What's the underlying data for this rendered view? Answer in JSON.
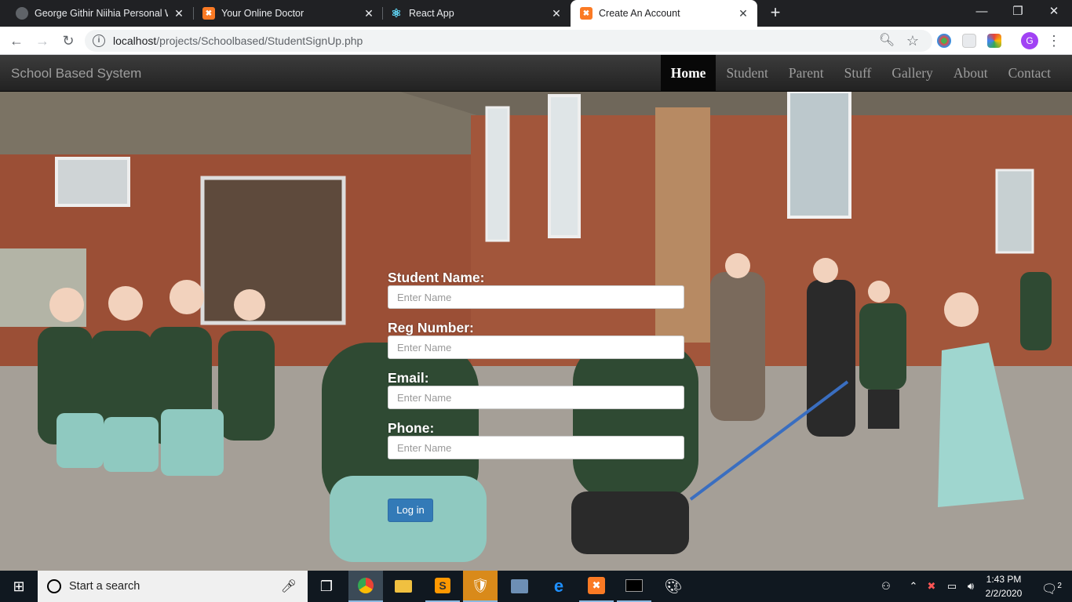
{
  "browser": {
    "tabs": [
      {
        "title": "George Githir Niihia Personal We",
        "icon": "globe-icon"
      },
      {
        "title": "Your Online Doctor",
        "icon": "xampp-icon"
      },
      {
        "title": "React App",
        "icon": "react-icon"
      },
      {
        "title": "Create An Account",
        "icon": "xampp-icon"
      }
    ],
    "close_glyph": "✕",
    "newtab_glyph": "+",
    "url_host": "localhost",
    "url_path": "/projects/Schoolbased/StudentSignUp.php",
    "avatar_letter": "G"
  },
  "site": {
    "brand": "School Based System",
    "nav": [
      "Home",
      "Student",
      "Parent",
      "Stuff",
      "Gallery",
      "About",
      "Contact"
    ],
    "active_nav": "Home"
  },
  "form": {
    "fields": [
      {
        "label": "Student Name:",
        "placeholder": "Enter Name"
      },
      {
        "label": "Reg Number:",
        "placeholder": "Enter Name"
      },
      {
        "label": "Email:",
        "placeholder": "Enter Name"
      },
      {
        "label": "Phone:",
        "placeholder": "Enter Name"
      }
    ],
    "submit_label": "Log in"
  },
  "taskbar": {
    "search_placeholder": "Start a search",
    "time": "1:43 PM",
    "date": "2/2/2020",
    "notification_count": "2"
  },
  "colors": {
    "navbar": "#222222",
    "button": "#337ab7",
    "tab_strip": "#202124"
  }
}
